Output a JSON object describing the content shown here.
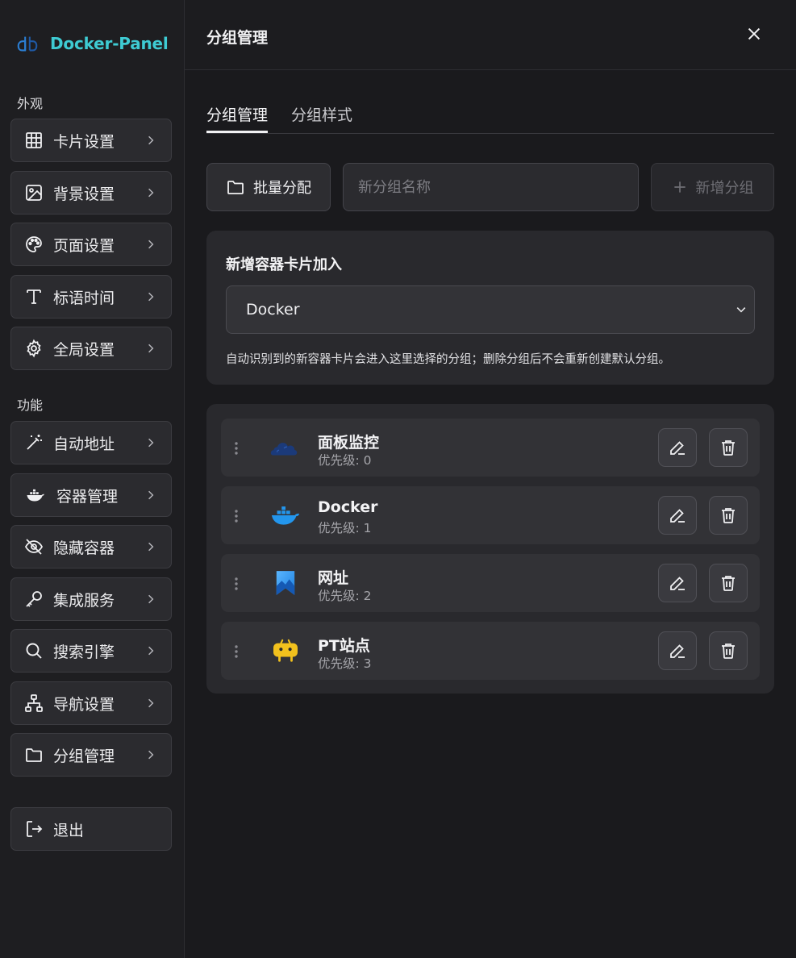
{
  "brand": {
    "title": "Docker-Panel"
  },
  "sidebar": {
    "sections": {
      "appearance": "外观",
      "features": "功能"
    },
    "appearance_items": [
      {
        "label": "卡片设置",
        "icon": "grid-icon"
      },
      {
        "label": "背景设置",
        "icon": "image-icon"
      },
      {
        "label": "页面设置",
        "icon": "palette-icon"
      },
      {
        "label": "标语时间",
        "icon": "text-icon"
      },
      {
        "label": "全局设置",
        "icon": "gear-icon"
      }
    ],
    "feature_items": [
      {
        "label": "自动地址",
        "icon": "magic-wand-icon"
      },
      {
        "label": "容器管理",
        "icon": "docker-whale-icon"
      },
      {
        "label": "隐藏容器",
        "icon": "eye-off-icon"
      },
      {
        "label": "集成服务",
        "icon": "key-icon"
      },
      {
        "label": "搜索引擎",
        "icon": "search-icon"
      },
      {
        "label": "导航设置",
        "icon": "sitemap-icon"
      },
      {
        "label": "分组管理",
        "icon": "folder-icon"
      }
    ],
    "logout": {
      "label": "退出",
      "icon": "logout-icon"
    }
  },
  "main": {
    "header_title": "分组管理",
    "tabs": [
      {
        "label": "分组管理",
        "active": true
      },
      {
        "label": "分组样式",
        "active": false
      }
    ],
    "toolbar": {
      "batch_label": "批量分配",
      "input_placeholder": "新分组名称",
      "add_label": "新增分组"
    },
    "new_container": {
      "title": "新增容器卡片加入",
      "selected": "Docker",
      "hint": "自动识别到的新容器卡片会进入这里选择的分组；删除分组后不会重新创建默认分组。"
    },
    "groups": [
      {
        "name": "面板监控",
        "priority": "优先级: 0",
        "icon": "cloud-icon"
      },
      {
        "name": "Docker",
        "priority": "优先级: 1",
        "icon": "docker-whale-icon"
      },
      {
        "name": "网址",
        "priority": "优先级: 2",
        "icon": "bookmark-icon"
      },
      {
        "name": "PT站点",
        "priority": "优先级: 3",
        "icon": "yellow-robot-icon"
      }
    ]
  },
  "colors": {
    "brand_accent": "#3ecbd3",
    "background": "#1c1c1f",
    "card": "#29292d",
    "row": "#323236"
  }
}
